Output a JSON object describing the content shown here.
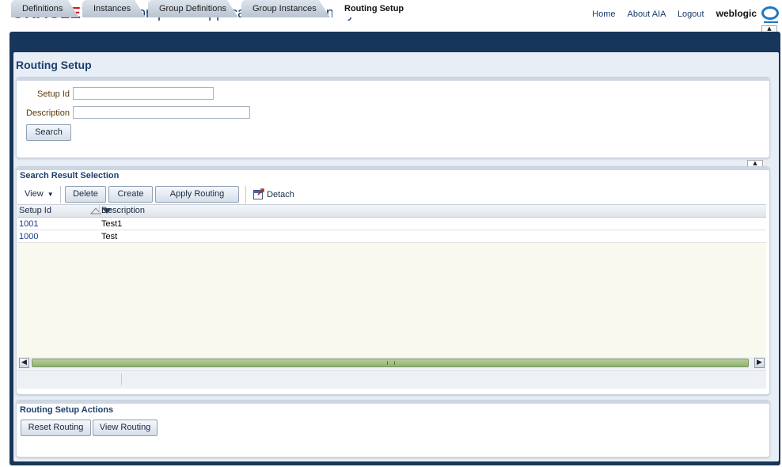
{
  "header": {
    "brand": "ORACLE",
    "app_title": "AIA Composite Application Validation System",
    "links": [
      "Home",
      "About AIA",
      "Logout"
    ],
    "user": "weblogic"
  },
  "tabs": [
    {
      "label": "Definitions",
      "active": false
    },
    {
      "label": "Instances",
      "active": false
    },
    {
      "label": "Group Definitions",
      "active": false
    },
    {
      "label": "Group Instances",
      "active": false
    },
    {
      "label": "Routing Setup",
      "active": true
    }
  ],
  "page": {
    "title": "Routing Setup"
  },
  "search": {
    "setup_id_label": "Setup Id",
    "setup_id_value": "",
    "description_label": "Description",
    "description_value": "",
    "search_button": "Search"
  },
  "results": {
    "title": "Search Result Selection",
    "view_menu": "View",
    "delete_button": "Delete",
    "create_button": "Create",
    "apply_routing_button": "Apply Routing",
    "detach_button": "Detach",
    "columns": [
      "Setup Id",
      "Description"
    ],
    "rows": [
      {
        "setup_id": "1001",
        "description": "Test1"
      },
      {
        "setup_id": "1000",
        "description": "Test"
      }
    ]
  },
  "actions": {
    "title": "Routing Setup Actions",
    "reset_button": "Reset Routing",
    "view_button": "View Routing"
  },
  "colors": {
    "brand_red": "#e0151b",
    "frame_navy": "#173659",
    "title_blue": "#1c3f6e",
    "scroll_green": "#8fb070"
  }
}
